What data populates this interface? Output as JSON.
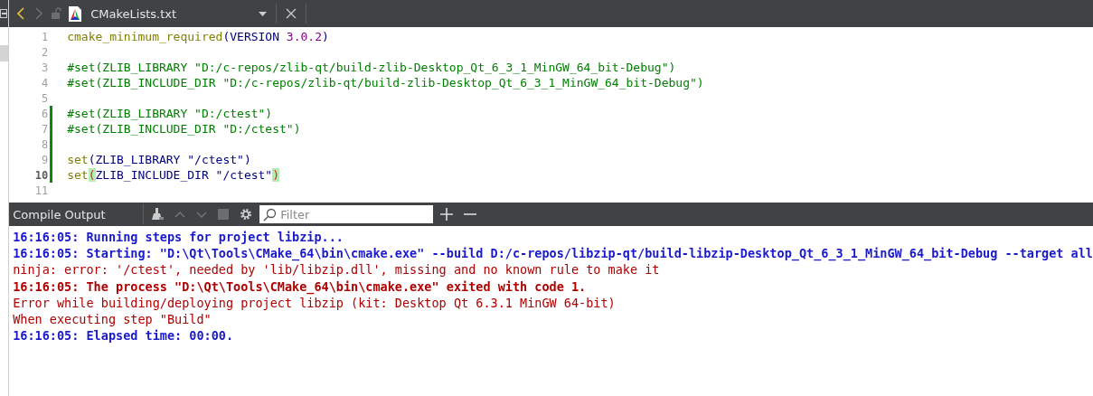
{
  "editor_toolbar": {
    "back": {
      "disabled": false
    },
    "forward": {
      "disabled": true
    },
    "file_name": "CMakeLists.txt"
  },
  "editor": {
    "lines": [
      {
        "number": "1",
        "current": false,
        "changed": false,
        "tokens": [
          {
            "text": "cmake_minimum_required",
            "kind": "command"
          },
          {
            "text": "(VERSION ",
            "kind": "plain"
          },
          {
            "text": "3.0.2",
            "kind": "number"
          },
          {
            "text": ")",
            "kind": "plain"
          }
        ]
      },
      {
        "number": "2",
        "current": false,
        "changed": false
      },
      {
        "number": "3",
        "current": false,
        "changed": false,
        "tokens": [
          {
            "text": "#set(ZLIB_LIBRARY \"D:/c-repos/zlib-qt/build-zlib-Desktop_Qt_6_3_1_MinGW_64_bit-Debug\")",
            "kind": "comment"
          }
        ]
      },
      {
        "number": "4",
        "current": false,
        "changed": false,
        "tokens": [
          {
            "text": "#set(ZLIB_INCLUDE_DIR \"D:/c-repos/zlib-qt/build-zlib-Desktop_Qt_6_3_1_MinGW_64_bit-Debug\")",
            "kind": "comment"
          }
        ]
      },
      {
        "number": "5",
        "current": false,
        "changed": false
      },
      {
        "number": "6",
        "current": false,
        "changed": true,
        "tokens": [
          {
            "text": "#set(ZLIB_LIBRARY \"D:/ctest\")",
            "kind": "comment"
          }
        ]
      },
      {
        "number": "7",
        "current": false,
        "changed": true,
        "tokens": [
          {
            "text": "#set(ZLIB_INCLUDE_DIR \"D:/ctest\")",
            "kind": "comment"
          }
        ]
      },
      {
        "number": "8",
        "current": false,
        "changed": true
      },
      {
        "number": "9",
        "current": false,
        "changed": true,
        "tokens": [
          {
            "text": "set",
            "kind": "command"
          },
          {
            "text": "(ZLIB_LIBRARY \"/ctest\")",
            "kind": "plain"
          }
        ]
      },
      {
        "number": "10",
        "current": true,
        "changed": true,
        "tokens": [
          {
            "text": "set",
            "kind": "command"
          },
          {
            "text": "(",
            "kind": "paren_match"
          },
          {
            "text": "ZLIB_INCLUDE_DIR \"/ctest\"",
            "kind": "plain"
          },
          {
            "text": ")",
            "kind": "paren_match"
          }
        ]
      },
      {
        "number": "11",
        "current": false,
        "changed": false
      }
    ]
  },
  "output_pane": {
    "title": "Compile Output",
    "filter": {
      "placeholder": "Filter"
    },
    "lines": [
      {
        "text": "16:16:05: Running steps for project libzip...",
        "kind": "step"
      },
      {
        "text": "16:16:05: Starting: \"D:\\Qt\\Tools\\CMake_64\\bin\\cmake.exe\" --build D:/c-repos/libzip-qt/build-libzip-Desktop_Qt_6_3_1_MinGW_64_bit-Debug --target all",
        "kind": "step"
      },
      {
        "text": "ninja: error: '/ctest', needed by 'lib/libzip.dll', missing and no known rule to make it",
        "kind": "error"
      },
      {
        "text": "16:16:05: The process \"D:\\Qt\\Tools\\CMake_64\\bin\\cmake.exe\" exited with code 1.",
        "kind": "failure"
      },
      {
        "text": "Error while building/deploying project libzip (kit: Desktop Qt 6.3.1 MinGW 64-bit)",
        "kind": "error"
      },
      {
        "text": "When executing step \"Build\"",
        "kind": "error"
      },
      {
        "text": "16:16:05: Elapsed time: 00:00.",
        "kind": "step"
      }
    ]
  }
}
